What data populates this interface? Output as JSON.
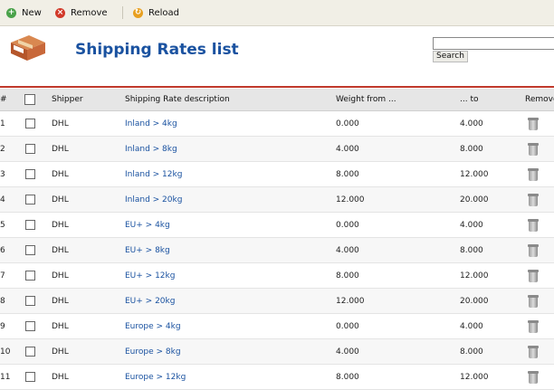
{
  "toolbar": {
    "new_label": "New",
    "remove_label": "Remove",
    "reload_label": "Reload",
    "new_icon": "plus-icon",
    "remove_icon": "remove-icon",
    "reload_icon": "reload-icon"
  },
  "header": {
    "title": "Shipping Rates list",
    "logo_icon": "shipping-box-icon",
    "search": {
      "value": "",
      "button_label": "Search"
    },
    "accent_color": "#c0392b",
    "title_color": "#1a52a0"
  },
  "table": {
    "columns": [
      "#",
      "",
      "Shipper",
      "Shipping Rate description",
      "Weight from ...",
      "... to",
      "Remove"
    ],
    "rows": [
      {
        "num": "1",
        "shipper": "DHL",
        "description": "Inland > 4kg",
        "from": "0.000",
        "to": "4.000"
      },
      {
        "num": "2",
        "shipper": "DHL",
        "description": "Inland > 8kg",
        "from": "4.000",
        "to": "8.000"
      },
      {
        "num": "3",
        "shipper": "DHL",
        "description": "Inland > 12kg",
        "from": "8.000",
        "to": "12.000"
      },
      {
        "num": "4",
        "shipper": "DHL",
        "description": "Inland > 20kg",
        "from": "12.000",
        "to": "20.000"
      },
      {
        "num": "5",
        "shipper": "DHL",
        "description": "EU+ > 4kg",
        "from": "0.000",
        "to": "4.000"
      },
      {
        "num": "6",
        "shipper": "DHL",
        "description": "EU+ > 8kg",
        "from": "4.000",
        "to": "8.000"
      },
      {
        "num": "7",
        "shipper": "DHL",
        "description": "EU+ > 12kg",
        "from": "8.000",
        "to": "12.000"
      },
      {
        "num": "8",
        "shipper": "DHL",
        "description": "EU+ > 20kg",
        "from": "12.000",
        "to": "20.000"
      },
      {
        "num": "9",
        "shipper": "DHL",
        "description": "Europe > 4kg",
        "from": "0.000",
        "to": "4.000"
      },
      {
        "num": "10",
        "shipper": "DHL",
        "description": "Europe > 8kg",
        "from": "4.000",
        "to": "8.000"
      },
      {
        "num": "11",
        "shipper": "DHL",
        "description": "Europe > 12kg",
        "from": "8.000",
        "to": "12.000"
      }
    ]
  }
}
